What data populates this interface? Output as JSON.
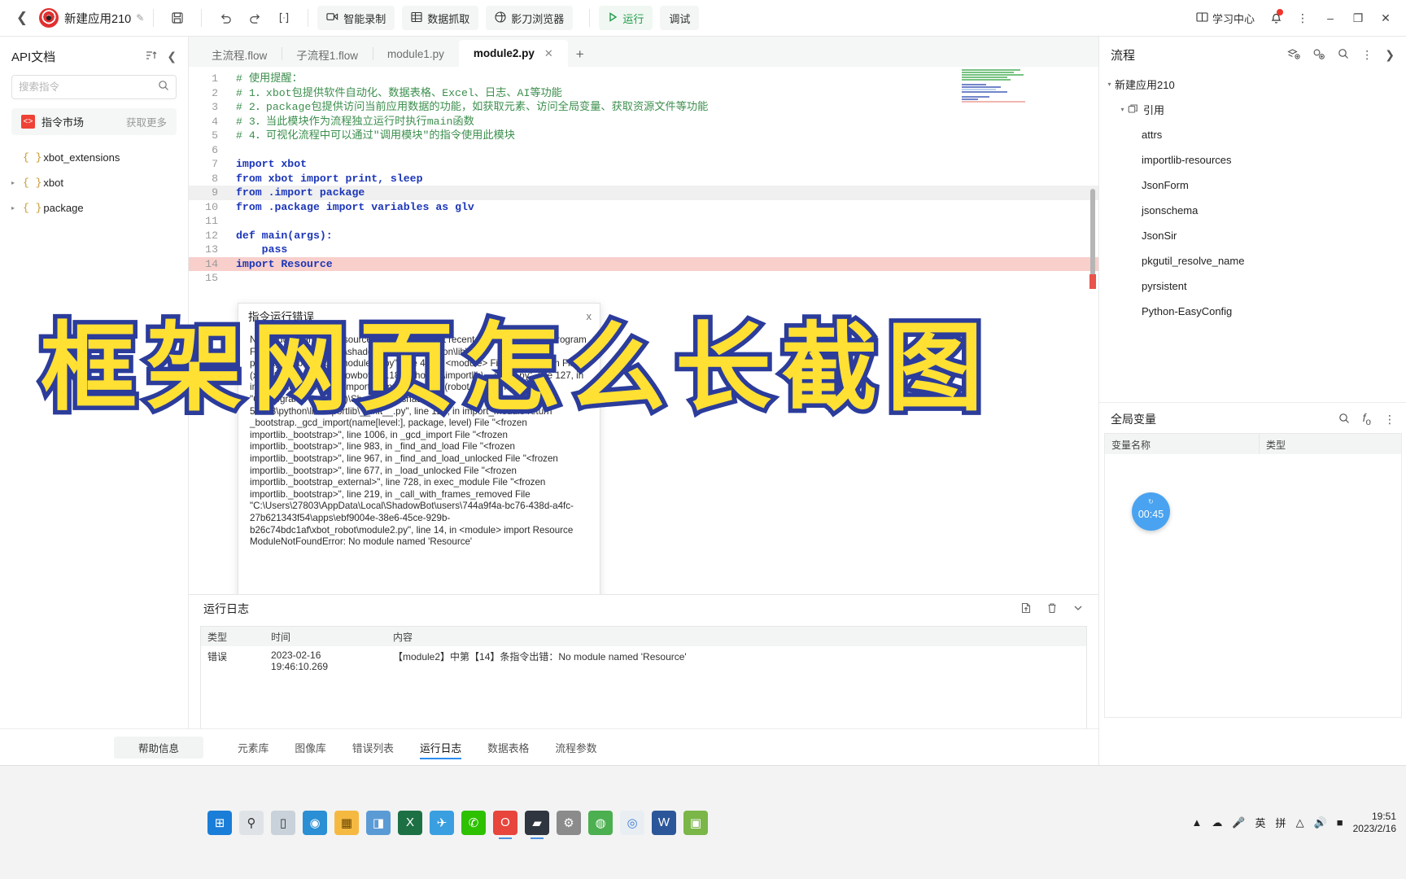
{
  "toolbar": {
    "back_icon": "chevron-left-icon",
    "app_title": "新建应用210",
    "edit_icon": "pencil-icon",
    "save_icon": "save-icon",
    "undo_icon": "undo-icon",
    "redo_icon": "redo-icon",
    "format_icon": "format-icon",
    "buttons": [
      {
        "label": "智能录制",
        "icon": "record-icon"
      },
      {
        "label": "数据抓取",
        "icon": "table-grab-icon"
      },
      {
        "label": "影刀浏览器",
        "icon": "browser-icon"
      }
    ],
    "run_label": "运行",
    "debug_label": "调试",
    "learn_center_label": "学习中心",
    "bell_icon": "bell-icon",
    "more_icon": "more-vertical-icon",
    "minimize": "–",
    "maximize": "❐",
    "close": "✕"
  },
  "left_panel": {
    "title": "API文档",
    "sort_icon": "sort-icon",
    "collapse_icon": "chevron-left-icon",
    "search": {
      "placeholder": "搜索指令",
      "value": "",
      "icon": "search-icon"
    },
    "market": {
      "label": "指令市场",
      "more_label": "获取更多",
      "icon": "market-icon"
    },
    "tree": [
      {
        "label": "xbot_extensions",
        "expandable": false
      },
      {
        "label": "xbot",
        "expandable": true
      },
      {
        "label": "package",
        "expandable": true
      }
    ]
  },
  "editor": {
    "tabs": [
      {
        "label": "主流程.flow",
        "active": false,
        "closable": false
      },
      {
        "label": "子流程1.flow",
        "active": false,
        "closable": false
      },
      {
        "label": "module1.py",
        "active": false,
        "closable": false
      },
      {
        "label": "module2.py",
        "active": true,
        "closable": true
      }
    ],
    "add_tab_icon": "plus-icon",
    "code": [
      {
        "n": "1",
        "text": "# 使用提醒：",
        "style": "comment"
      },
      {
        "n": "2",
        "text": "# 1．xbot包提供软件自动化、数据表格、Excel、日志、AI等功能",
        "style": "comment"
      },
      {
        "n": "3",
        "text": "# 2．package包提供访问当前应用数据的功能，如获取元素、访问全局变量、获取资源文件等功能",
        "style": "comment"
      },
      {
        "n": "4",
        "text": "# 3．当此模块作为流程独立运行时执行main函数",
        "style": "comment"
      },
      {
        "n": "5",
        "text": "# 4．可视化流程中可以通过\"调用模块\"的指令使用此模块",
        "style": "comment"
      },
      {
        "n": "6",
        "text": "",
        "style": "plain"
      },
      {
        "n": "7",
        "text": "import xbot",
        "style": "code"
      },
      {
        "n": "8",
        "text": "from xbot import print, sleep",
        "style": "code"
      },
      {
        "n": "9",
        "text": "from .import package",
        "style": "code",
        "highlight": "gray"
      },
      {
        "n": "10",
        "text": "from .package import variables as glv",
        "style": "code"
      },
      {
        "n": "11",
        "text": "",
        "style": "plain"
      },
      {
        "n": "12",
        "text": "def main(args):",
        "style": "code"
      },
      {
        "n": "13",
        "text": "    pass",
        "style": "code"
      },
      {
        "n": "14",
        "text": "import Resource",
        "style": "code",
        "highlight": "error"
      },
      {
        "n": "15",
        "text": "",
        "style": "plain"
      }
    ]
  },
  "error_dialog": {
    "title": "指令运行错误",
    "close_icon": "close-icon",
    "message": "No module named 'Resource' Traceback (most recent call last): File \"C:\\Program Files (x86)\\ShadowBot\\shadowbot-5.8.18\\python\\lib\\site-packages\\xbot_robot\\module_a.py\", line 41, in <module> File \"C:\\Program Files (x86)\\ShadowBot\\shadowbot-5.8.18\\python\\lib\\importlib\\__init__.py\", line 127, in import_module mod = importlib.import_module(robot_inputs['mod']) File \"C:\\Program Files (x86)\\ShadowBot\\shadowbot-5.8.18\\python\\lib\\importlib\\__init__.py\", line 127, in import_module return _bootstrap._gcd_import(name[level:], package, level) File \"<frozen importlib._bootstrap>\", line 1006, in _gcd_import File \"<frozen importlib._bootstrap>\", line 983, in _find_and_load File \"<frozen importlib._bootstrap>\", line 967, in _find_and_load_unlocked File \"<frozen importlib._bootstrap>\", line 677, in _load_unlocked File \"<frozen importlib._bootstrap_external>\", line 728, in exec_module File \"<frozen importlib._bootstrap>\", line 219, in _call_with_frames_removed File \"C:\\Users\\27803\\AppData\\Local\\ShadowBot\\users\\744a9f4a-bc76-438d-a4fc-27b621343f54\\apps\\ebf9004e-38e6-45ce-929b-b26c74bdc1af\\xbot_robot\\module2.py\", line 14, in <module> import Resource ModuleNotFoundError: No module named 'Resource'"
  },
  "log_panel": {
    "title": "运行日志",
    "export_icon": "export-icon",
    "clear_icon": "trash-icon",
    "collapse_icon": "chevron-down-icon",
    "columns": [
      "类型",
      "时间",
      "内容"
    ],
    "rows": [
      {
        "type": "错误",
        "time": "2023-02-16 19:46:10.269",
        "content": "【module2】中第【14】条指令出错：No module named 'Resource'"
      }
    ]
  },
  "bottom_tabs": {
    "help_label": "帮助信息",
    "tabs": [
      {
        "label": "元素库",
        "active": false
      },
      {
        "label": "图像库",
        "active": false
      },
      {
        "label": "错误列表",
        "active": false
      },
      {
        "label": "运行日志",
        "active": true
      },
      {
        "label": "数据表格",
        "active": false
      },
      {
        "label": "流程参数",
        "active": false
      }
    ]
  },
  "right_panel": {
    "title": "流程",
    "icons": [
      "add-flow-icon",
      "add-module-icon",
      "search-icon",
      "more-vertical-icon",
      "chevron-right-icon"
    ],
    "tree": [
      {
        "label": "新建应用210",
        "level": 0,
        "caret": "▾"
      },
      {
        "label": "引用",
        "level": 1,
        "caret": "▾",
        "icon": "package-icon"
      },
      {
        "label": "attrs",
        "level": 2,
        "caret": ""
      },
      {
        "label": "importlib-resources",
        "level": 2,
        "caret": ""
      },
      {
        "label": "JsonForm",
        "level": 2,
        "caret": ""
      },
      {
        "label": "jsonschema",
        "level": 2,
        "caret": ""
      },
      {
        "label": "JsonSir",
        "level": 2,
        "caret": ""
      },
      {
        "label": "pkgutil_resolve_name",
        "level": 2,
        "caret": ""
      },
      {
        "label": "pyrsistent",
        "level": 2,
        "caret": ""
      },
      {
        "label": "Python-EasyConfig",
        "level": 2,
        "caret": ""
      }
    ],
    "global_vars": {
      "title": "全局变量",
      "search_icon": "search-icon",
      "func_icon": "function-icon",
      "more_icon": "more-vertical-icon",
      "columns": [
        "变量名称",
        "类型"
      ],
      "rows": []
    },
    "timer": {
      "label": "",
      "value": "00:45"
    }
  },
  "taskbar": {
    "items": [
      {
        "name": "start-icon",
        "color": "#1a7ed8",
        "glyph": "⊞"
      },
      {
        "name": "search-icon",
        "color": "#e8e8e8",
        "glyph": "🔍"
      },
      {
        "name": "task-view-icon",
        "color": "#cfd6dd",
        "glyph": "▭"
      },
      {
        "name": "edge-icon",
        "color": "#2a8fd4",
        "glyph": "◉"
      },
      {
        "name": "file-explorer-icon",
        "color": "#f5b942",
        "glyph": "▤"
      },
      {
        "name": "app-blue-icon",
        "color": "#5b9bd5",
        "glyph": "◨"
      },
      {
        "name": "excel-icon",
        "color": "#1d7044",
        "glyph": "X"
      },
      {
        "name": "telegram-icon",
        "color": "#3a9fe0",
        "glyph": "✈"
      },
      {
        "name": "wechat-icon",
        "color": "#2dc100",
        "glyph": "✆"
      },
      {
        "name": "opera-icon",
        "color": "#e8453c",
        "glyph": "O"
      },
      {
        "name": "shadowbot-icon",
        "color": "#2f3640",
        "glyph": "▰"
      },
      {
        "name": "settings-icon",
        "color": "#8b8b8b",
        "glyph": "⚙"
      },
      {
        "name": "chrome-alt-icon",
        "color": "#4caf50",
        "glyph": "◍"
      },
      {
        "name": "chrome-icon",
        "color": "#f2f2f2",
        "glyph": "◎"
      },
      {
        "name": "word-icon",
        "color": "#2b579a",
        "glyph": "W"
      },
      {
        "name": "app-green-icon",
        "color": "#7ab648",
        "glyph": "▣"
      }
    ],
    "tray": {
      "up_icon": "chevron-up-icon",
      "cloud_icon": "cloud-icon",
      "mic_icon": "mic-icon",
      "ime_label": "英",
      "ime_mode": "拼",
      "wifi_icon": "wifi-icon",
      "volume_icon": "volume-icon",
      "battery_icon": "battery-icon",
      "time": "19:51",
      "date": "2023/2/16"
    }
  },
  "overlay": {
    "text": "框架网页怎么长截图"
  }
}
